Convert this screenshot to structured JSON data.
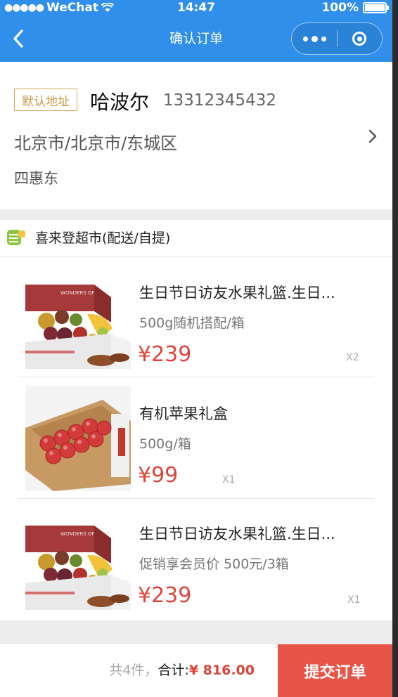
{
  "status_bar": {
    "carrier": "WeChat",
    "time": "14:47",
    "battery": "100%"
  },
  "navbar": {
    "title": "确认订单"
  },
  "address": {
    "tag": "默认地址",
    "name": "哈波尔",
    "phone": "13312345432",
    "region": "北京市/北京市/东城区",
    "street": "四惠东"
  },
  "shop": {
    "name": "喜来登超市(配送/自提)"
  },
  "products": [
    {
      "title": "生日节日访友水果礼篮.生日...",
      "spec": "500g随机搭配/箱",
      "price": "¥239",
      "qty": "X2"
    },
    {
      "title": "有机苹果礼盒",
      "spec": "500g/箱",
      "price": "¥99",
      "qty": "X1"
    },
    {
      "title": "生日节日访友水果礼篮.生日...",
      "spec": "促销享会员价 500元/3箱",
      "price": "¥239",
      "qty": "X1"
    }
  ],
  "footer": {
    "count_text": "共4件，",
    "total_label": "合计:",
    "total_value": "¥ 816.00",
    "submit_label": "提交订单"
  }
}
